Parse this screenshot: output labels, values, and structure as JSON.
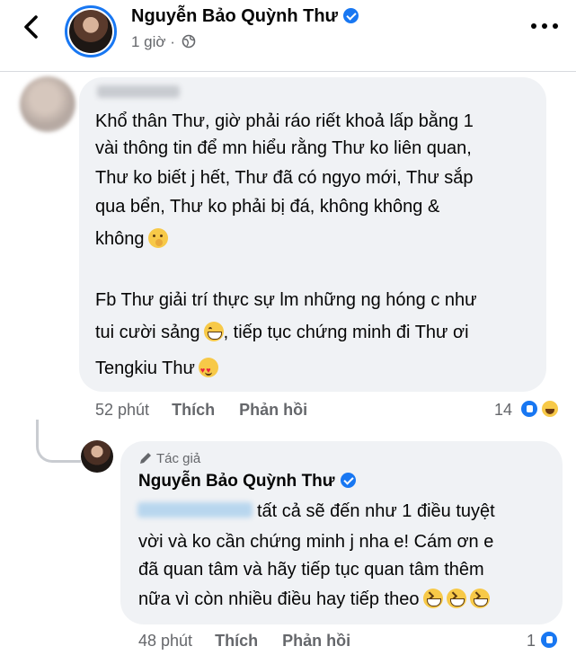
{
  "header": {
    "name": "Nguyễn Bảo Quỳnh Thư",
    "time": "1 giờ",
    "separator": "·"
  },
  "comment": {
    "lines": [
      "Khổ thân Thư, giờ phải ráo riết khoả lấp bằng 1",
      "vài thông tin để mn hiểu rằng Thư ko liên quan,",
      "Thư ko biết j hết, Thư đã có ngyo mới, Thư sắp",
      "qua bển, Thư ko phải bị đá, không không &",
      "không",
      "Fb Thư giải trí thực sự lm những ng hóng c như",
      "tui cười sảng",
      ", tiếp tục chứng minh đi Thư ơi",
      "Tengkiu Thư"
    ],
    "time": "52 phút",
    "like_label": "Thích",
    "reply_label": "Phản hồi",
    "reaction_count": "14"
  },
  "reply": {
    "badge": "Tác giả",
    "name": "Nguyễn Bảo Quỳnh Thư",
    "lines": [
      "tất cả sẽ đến như 1 điều tuyệt",
      "vời và ko cần chứng minh j nha e! Cám ơn e",
      "đã quan tâm và hãy tiếp tục quan tâm thêm",
      "nữa vì còn nhiều điều hay tiếp theo"
    ],
    "time": "48 phút",
    "like_label": "Thích",
    "reply_label": "Phản hồi",
    "reaction_count": "1"
  },
  "icons": {
    "back": "chevron-left-icon",
    "more": "more-dots-icon",
    "privacy": "globe-icon",
    "verified": "verified-badge-icon",
    "author": "pencil-icon"
  },
  "colors": {
    "accent": "#1877f2",
    "bubble": "#f0f2f5",
    "muted": "#65676b"
  }
}
